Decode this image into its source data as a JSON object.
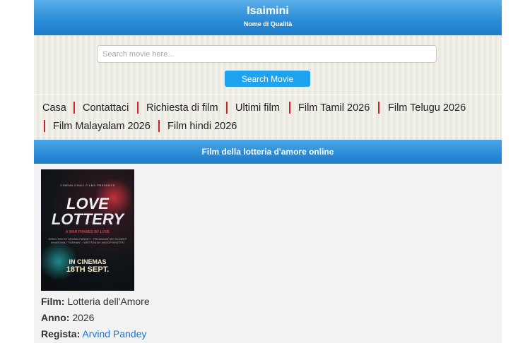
{
  "header": {
    "title": "Isaimini",
    "subtitle": "Nome di Qualità"
  },
  "search": {
    "placeholder": "Search movie here...",
    "value": "",
    "button_label": "Search Movie"
  },
  "nav": {
    "items": [
      "Casa",
      "Contattaci",
      "Richiesta di film",
      "Ultimi film",
      "Film Tamil 2026",
      "Film Telugu 2026",
      "Film Malayalam 2026",
      "Film hindi 2026"
    ]
  },
  "section": {
    "title": "Film della lotteria d'amore online"
  },
  "poster": {
    "top_text": "CINEMA GHALI FILMS PRESENTS",
    "title_line1": "LOVE",
    "title_line2": "LOTTERY",
    "tagline": "A WAR FRAMED BY LOVE",
    "credits": "DIRECTED BY ARVIND PANDEY · PRODUCED BY DILDEEP BHARDWAJ \"FARHAN\" · WRITTEN BY ANOOP BHATTRI",
    "cinemas": "IN CINEMAS",
    "date": "18TH SEPT."
  },
  "movie": {
    "film_label": "Film:",
    "film_value": "Lotteria dell'Amore",
    "year_label": "Anno:",
    "year_value": "2026",
    "director_label": "Regista:",
    "director_value": "Arvind Pandey"
  },
  "colors": {
    "header_blue": "#2a8bd6",
    "button_blue": "#1fa3ee",
    "nav_separator": "#d21f1f",
    "link": "#1a73d9",
    "nav_bg": "#ece9e0"
  }
}
